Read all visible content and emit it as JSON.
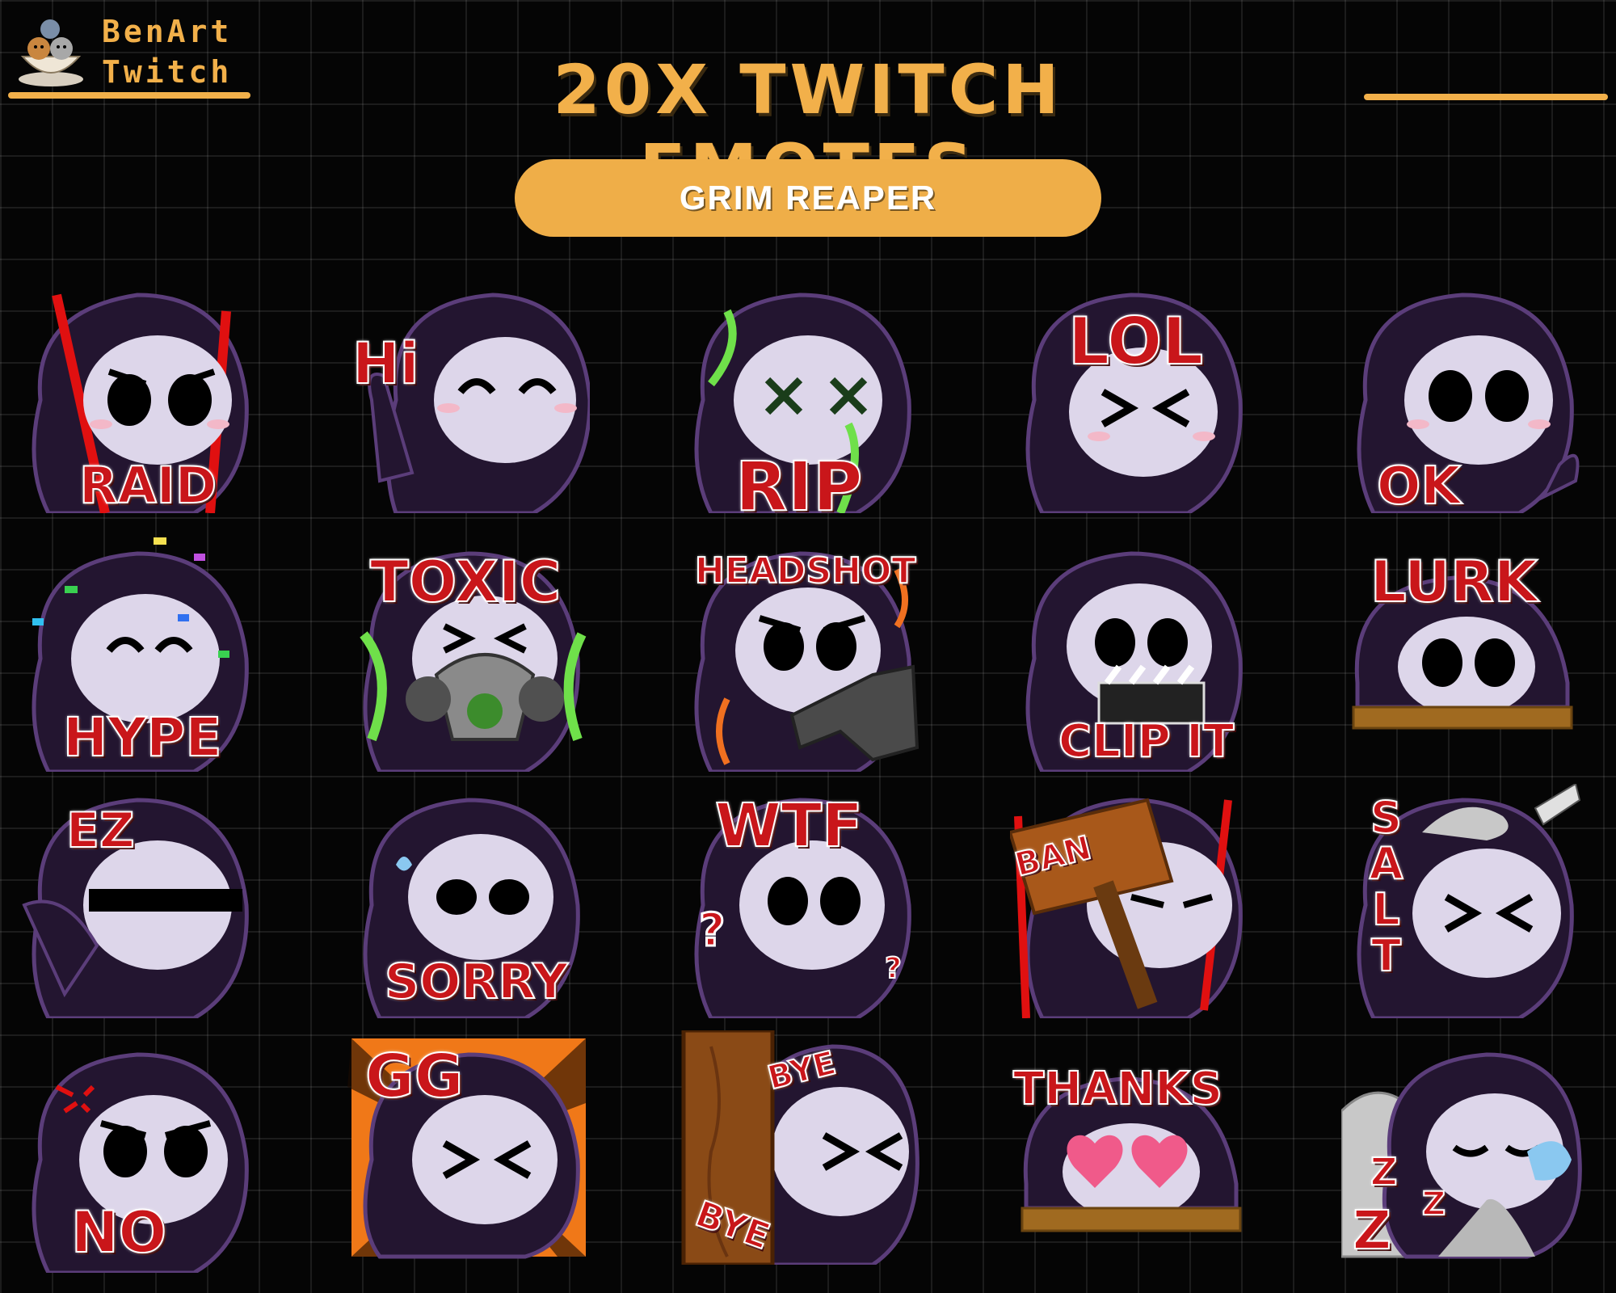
{
  "brand": {
    "name": "BenArt\nTwitch"
  },
  "header": {
    "title": "20X TWITCH EMOTES",
    "subtitle": "GRIM REAPER"
  },
  "emotes": [
    {
      "label": "RAID"
    },
    {
      "label": "Hi"
    },
    {
      "label": "RIP"
    },
    {
      "label": "LOL"
    },
    {
      "label": "OK"
    },
    {
      "label": "HYPE"
    },
    {
      "label": "TOXIC"
    },
    {
      "label": "HEADSHOT"
    },
    {
      "label": "CLIP IT"
    },
    {
      "label": "LURK"
    },
    {
      "label": "EZ"
    },
    {
      "label": "SORRY"
    },
    {
      "label": "WTF"
    },
    {
      "label": "BAN"
    },
    {
      "label": "SALT"
    },
    {
      "label": "NO"
    },
    {
      "label": "GG"
    },
    {
      "label": "BYE",
      "label2": "BYE"
    },
    {
      "label": "THANKS"
    },
    {
      "label": "Z",
      "label2": "Z",
      "label3": "Z"
    }
  ],
  "colors": {
    "accent": "#f2b04a",
    "label_red": "#c9161a",
    "hood": "#231530",
    "skull": "#ddd6ea"
  }
}
